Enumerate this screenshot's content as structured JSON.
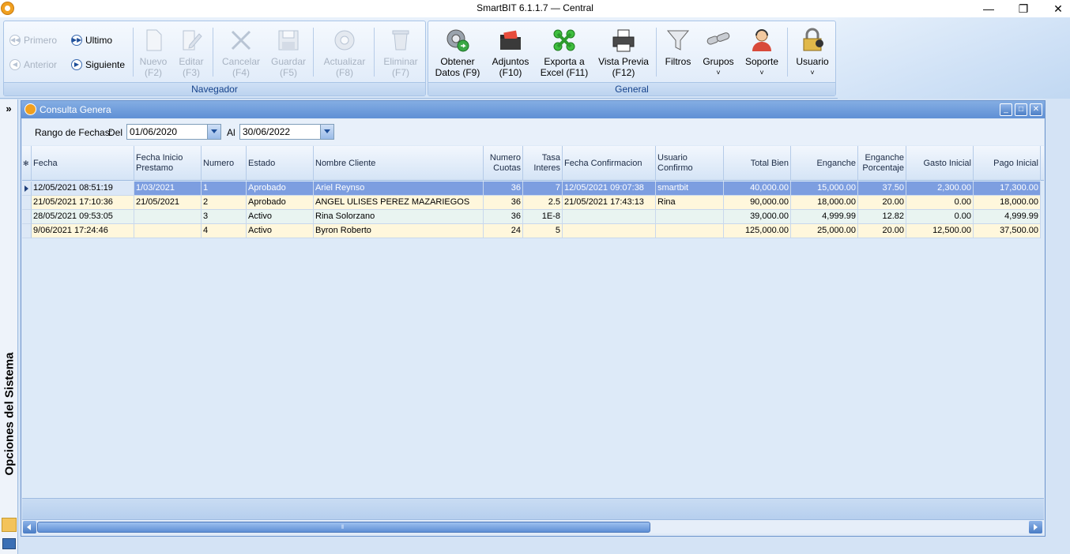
{
  "window": {
    "title": "SmartBIT 6.1.1.7 — Central",
    "minimize": "—",
    "restore": "❐",
    "close": "✕"
  },
  "ribbon": {
    "navegador": {
      "caption": "Navegador",
      "primero": "Primero",
      "anterior": "Anterior",
      "ultimo": "Ultimo",
      "siguiente": "Siguiente",
      "nuevo": [
        "Nuevo",
        "(F2)"
      ],
      "editar": [
        "Editar",
        "(F3)"
      ],
      "cancelar": [
        "Cancelar",
        "(F4)"
      ],
      "guardar": [
        "Guardar",
        "(F5)"
      ],
      "actualizar": [
        "Actualizar",
        "(F8)"
      ],
      "eliminar": [
        "Eliminar",
        "(F7)"
      ]
    },
    "general": {
      "caption": "General",
      "obtener": [
        "Obtener",
        "Datos (F9)"
      ],
      "adjuntos": [
        "Adjuntos",
        "(F10)"
      ],
      "exporta": [
        "Exporta a",
        "Excel (F11)"
      ],
      "vista_previa": [
        "Vista Previa",
        "(F12)"
      ],
      "filtros": "Filtros",
      "grupos": "Grupos",
      "soporte": "Soporte",
      "usuario": "Usuario"
    }
  },
  "sidebar": {
    "expand": "»",
    "label": "Opciones del Sistema"
  },
  "child_window": {
    "title": "Consulta Genera"
  },
  "filter": {
    "rango_label": "Rango de Fechas:",
    "del_label": "Del",
    "del_value": "01/06/2020",
    "al_label": "Al",
    "al_value": "30/06/2022"
  },
  "grid": {
    "indicator_header": "✻",
    "columns": [
      {
        "lines": [
          "Fecha"
        ],
        "align": "left"
      },
      {
        "lines": [
          "Fecha Inicio",
          "Prestamo"
        ],
        "align": "left"
      },
      {
        "lines": [
          "Numero"
        ],
        "align": "left"
      },
      {
        "lines": [
          "Estado"
        ],
        "align": "left"
      },
      {
        "lines": [
          "Nombre Cliente"
        ],
        "align": "left"
      },
      {
        "lines": [
          "Numero",
          "Cuotas"
        ],
        "align": "right"
      },
      {
        "lines": [
          "Tasa",
          "Interes"
        ],
        "align": "right"
      },
      {
        "lines": [
          "Fecha Confirmacion"
        ],
        "align": "left"
      },
      {
        "lines": [
          "Usuario",
          "Confirmo"
        ],
        "align": "left"
      },
      {
        "lines": [
          "Total Bien"
        ],
        "align": "right"
      },
      {
        "lines": [
          "Enganche"
        ],
        "align": "right"
      },
      {
        "lines": [
          "Enganche",
          "Porcentaje"
        ],
        "align": "right"
      },
      {
        "lines": [
          "Gasto Inicial"
        ],
        "align": "right"
      },
      {
        "lines": [
          "Pago Inicial"
        ],
        "align": "right"
      }
    ],
    "rows": [
      [
        "12/05/2021 08:51:19",
        "1/03/2021",
        "1",
        "Aprobado",
        "Ariel Reynso",
        "36",
        "7",
        "12/05/2021 09:07:38",
        "smartbit",
        "40,000.00",
        "15,000.00",
        "37.50",
        "2,300.00",
        "17,300.00"
      ],
      [
        "21/05/2021 17:10:36",
        "21/05/2021",
        "2",
        "Aprobado",
        "ANGEL ULISES PEREZ MAZARIEGOS",
        "36",
        "2.5",
        "21/05/2021 17:43:13",
        "Rina",
        "90,000.00",
        "18,000.00",
        "20.00",
        "0.00",
        "18,000.00"
      ],
      [
        "28/05/2021 09:53:05",
        "",
        "3",
        "Activo",
        "Rina Solorzano",
        "36",
        "1E-8",
        "",
        "",
        "39,000.00",
        "4,999.99",
        "12.82",
        "0.00",
        "4,999.99"
      ],
      [
        "9/06/2021 17:24:46",
        "",
        "4",
        "Activo",
        "Byron Roberto",
        "24",
        "5",
        "",
        "",
        "125,000.00",
        "25,000.00",
        "20.00",
        "12,500.00",
        "37,500.00"
      ]
    ],
    "selected_row": 0
  }
}
